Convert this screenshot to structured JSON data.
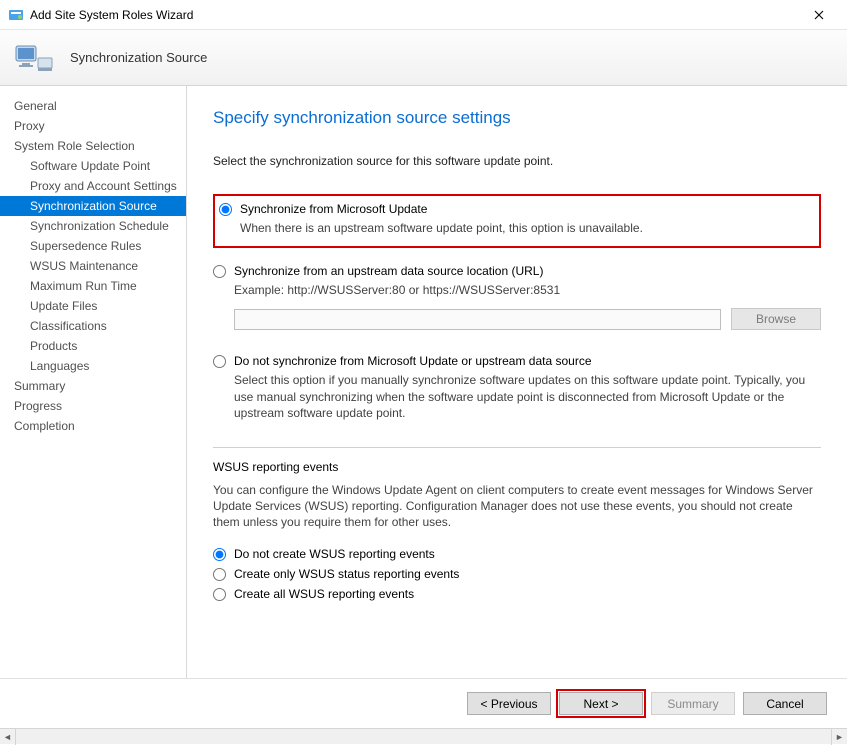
{
  "window": {
    "title": "Add Site System Roles Wizard"
  },
  "header": {
    "subtitle": "Synchronization Source"
  },
  "sidebar": {
    "items": [
      {
        "label": "General",
        "sub": false,
        "sel": false
      },
      {
        "label": "Proxy",
        "sub": false,
        "sel": false
      },
      {
        "label": "System Role Selection",
        "sub": false,
        "sel": false
      },
      {
        "label": "Software Update Point",
        "sub": true,
        "sel": false
      },
      {
        "label": "Proxy and Account Settings",
        "sub": true,
        "sel": false
      },
      {
        "label": "Synchronization Source",
        "sub": true,
        "sel": true
      },
      {
        "label": "Synchronization Schedule",
        "sub": true,
        "sel": false
      },
      {
        "label": "Supersedence Rules",
        "sub": true,
        "sel": false
      },
      {
        "label": "WSUS Maintenance",
        "sub": true,
        "sel": false
      },
      {
        "label": "Maximum Run Time",
        "sub": true,
        "sel": false
      },
      {
        "label": "Update Files",
        "sub": true,
        "sel": false
      },
      {
        "label": "Classifications",
        "sub": true,
        "sel": false
      },
      {
        "label": "Products",
        "sub": true,
        "sel": false
      },
      {
        "label": "Languages",
        "sub": true,
        "sel": false
      },
      {
        "label": "Summary",
        "sub": false,
        "sel": false
      },
      {
        "label": "Progress",
        "sub": false,
        "sel": false
      },
      {
        "label": "Completion",
        "sub": false,
        "sel": false
      }
    ]
  },
  "content": {
    "heading": "Specify synchronization source settings",
    "intro": "Select the synchronization source for this software update point.",
    "opt1": {
      "label": "Synchronize from Microsoft Update",
      "desc": "When there is an upstream software update point, this option is unavailable."
    },
    "opt2": {
      "label": "Synchronize from an upstream data source location (URL)",
      "example": "Example: http://WSUSServer:80 or https://WSUSServer:8531",
      "browse": "Browse"
    },
    "opt3": {
      "label": "Do not synchronize from Microsoft Update or upstream data source",
      "desc": "Select this option if you manually synchronize software updates on this software update point. Typically, you use manual synchronizing when the software update point is disconnected from Microsoft Update or the upstream software update point."
    },
    "wsus_section": {
      "title": "WSUS reporting events",
      "desc": "You can configure the Windows Update Agent on client computers to create event messages for Windows Server Update Services (WSUS) reporting. Configuration Manager does not use these events, you should not create them unless you require them for other uses.",
      "r1": "Do not create WSUS reporting events",
      "r2": "Create only WSUS status reporting events",
      "r3": "Create all WSUS reporting events"
    }
  },
  "footer": {
    "previous": "< Previous",
    "next": "Next >",
    "summary": "Summary",
    "cancel": "Cancel"
  }
}
